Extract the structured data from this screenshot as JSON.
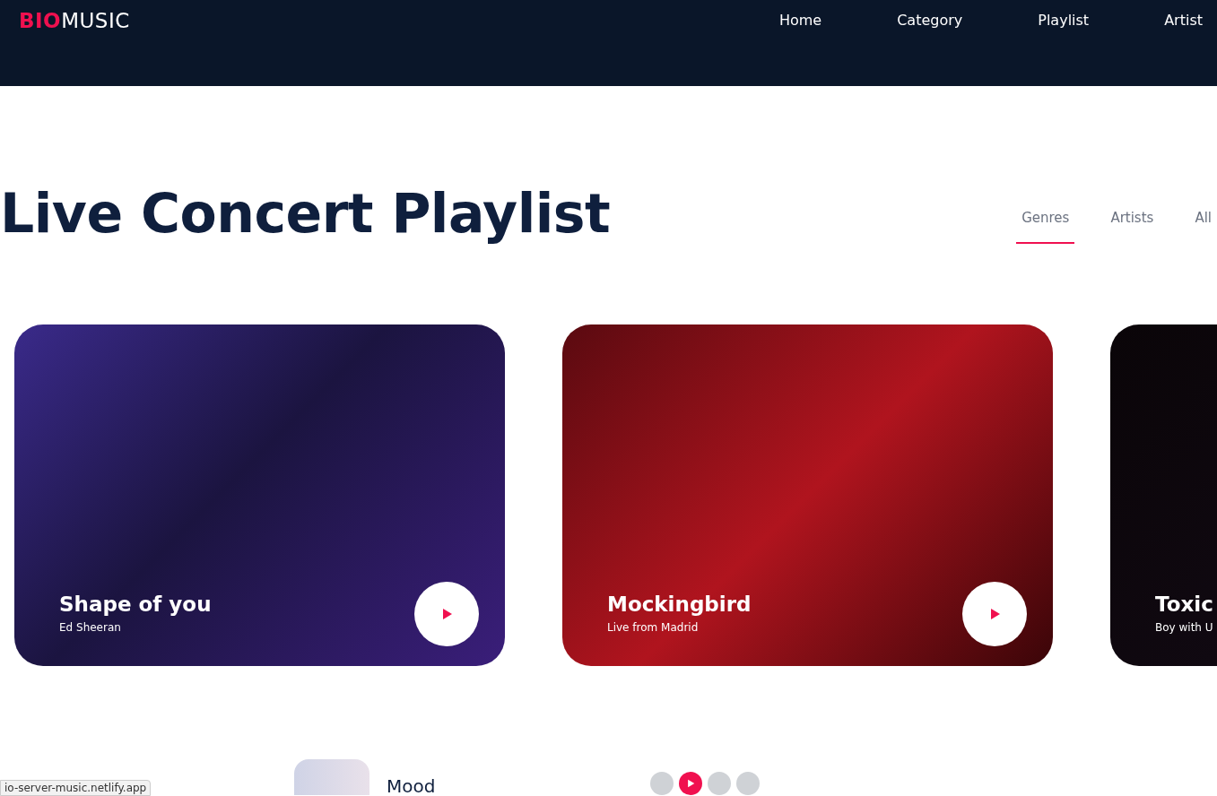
{
  "brand": {
    "highlight": "BIO",
    "rest": "MUSIC"
  },
  "nav": [
    {
      "label": "Home"
    },
    {
      "label": "Category"
    },
    {
      "label": "Playlist"
    },
    {
      "label": "Artist"
    }
  ],
  "title": "Live Concert Playlist",
  "filters": [
    {
      "label": "Genres",
      "selected": true
    },
    {
      "label": "Artists",
      "selected": false
    },
    {
      "label": "All",
      "selected": false
    }
  ],
  "cards": [
    {
      "title": "Shape of you",
      "subtitle": "Ed Sheeran"
    },
    {
      "title": "Mockingbird",
      "subtitle": "Live from Madrid"
    },
    {
      "title": "Toxic",
      "subtitle": "Boy with U"
    }
  ],
  "now_playing": {
    "title": "Mood"
  },
  "pager": [
    {
      "selected": false
    },
    {
      "selected": true
    },
    {
      "selected": false
    },
    {
      "selected": false
    }
  ],
  "status_url": "io-server-music.netlify.app"
}
